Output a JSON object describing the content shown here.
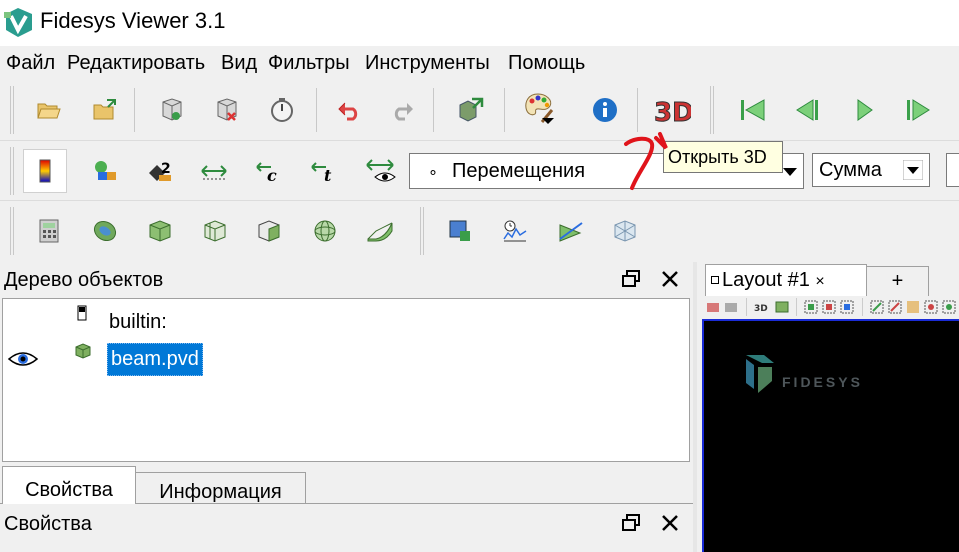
{
  "window": {
    "title": "Fidesys Viewer 3.1"
  },
  "menu": {
    "items": [
      "Файл",
      "Редактировать",
      "Вид",
      "Фильтры",
      "Инструменты",
      "Помощь"
    ]
  },
  "toolbar_main": {
    "icons": [
      "open-folder-icon",
      "load-state-icon",
      "save-state-icon",
      "delete-state-icon",
      "timer-icon",
      "undo-icon",
      "redo-icon",
      "export-icon",
      "color-palette-icon",
      "info-icon",
      "open-3d-icon",
      "first-frame-icon",
      "previous-frame-icon",
      "play-icon",
      "next-frame-icon"
    ]
  },
  "tooltip": {
    "text": "Открыть 3D"
  },
  "toolbar_display": {
    "field_combo": {
      "bullet": "∘",
      "value": "Перемещения"
    },
    "component_combo": {
      "value": "Сумма"
    }
  },
  "objects_panel": {
    "title": "Дерево объектов",
    "items": [
      {
        "label": "builtin:",
        "visible": false
      },
      {
        "label": "beam.pvd",
        "visible": true,
        "selected": true
      }
    ]
  },
  "properties_tabs": {
    "tabs": [
      "Свойства",
      "Информация"
    ],
    "active": 0
  },
  "properties_panel": {
    "title": "Свойства"
  },
  "layout_tabs": {
    "tabs": [
      {
        "label": "Layout #1",
        "close": "×"
      }
    ],
    "add_label": "+"
  },
  "render_view": {
    "logo_text": "FIDESYS"
  },
  "colors": {
    "selection": "#0078d7",
    "view_border": "#1a2bd6",
    "annotation": "#e0141b"
  }
}
